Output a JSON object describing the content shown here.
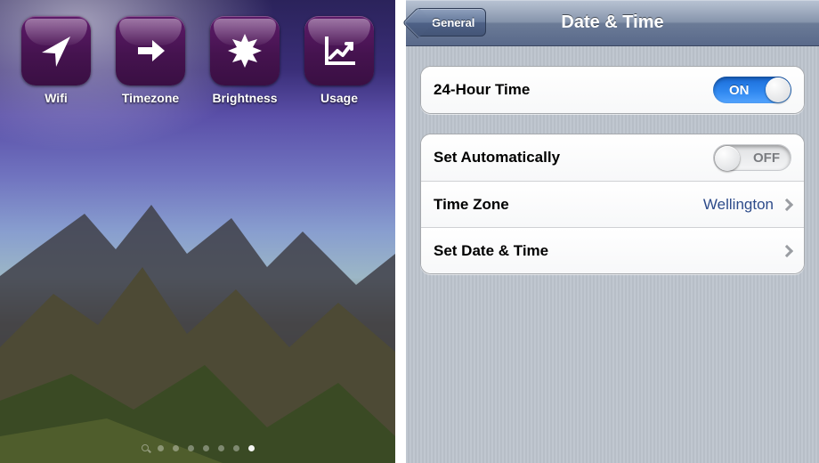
{
  "home": {
    "apps": [
      {
        "label": "Wifi",
        "icon": "location-arrow-icon"
      },
      {
        "label": "Timezone",
        "icon": "arrow-right-icon"
      },
      {
        "label": "Brightness",
        "icon": "starburst-icon"
      },
      {
        "label": "Usage",
        "icon": "chart-line-icon"
      }
    ],
    "page_count": 7,
    "active_page_index": 6
  },
  "settings": {
    "back_label": "General",
    "title": "Date & Time",
    "group1": {
      "twentyfour_label": "24-Hour Time",
      "twentyfour_state": "ON"
    },
    "group2": {
      "auto_label": "Set Automatically",
      "auto_state": "OFF",
      "tz_label": "Time Zone",
      "tz_value": "Wellington",
      "setdt_label": "Set Date & Time"
    }
  },
  "colors": {
    "tile_bg": "#45134f",
    "toggle_on": "#2f87ef",
    "link_value": "#2d4b8a"
  }
}
